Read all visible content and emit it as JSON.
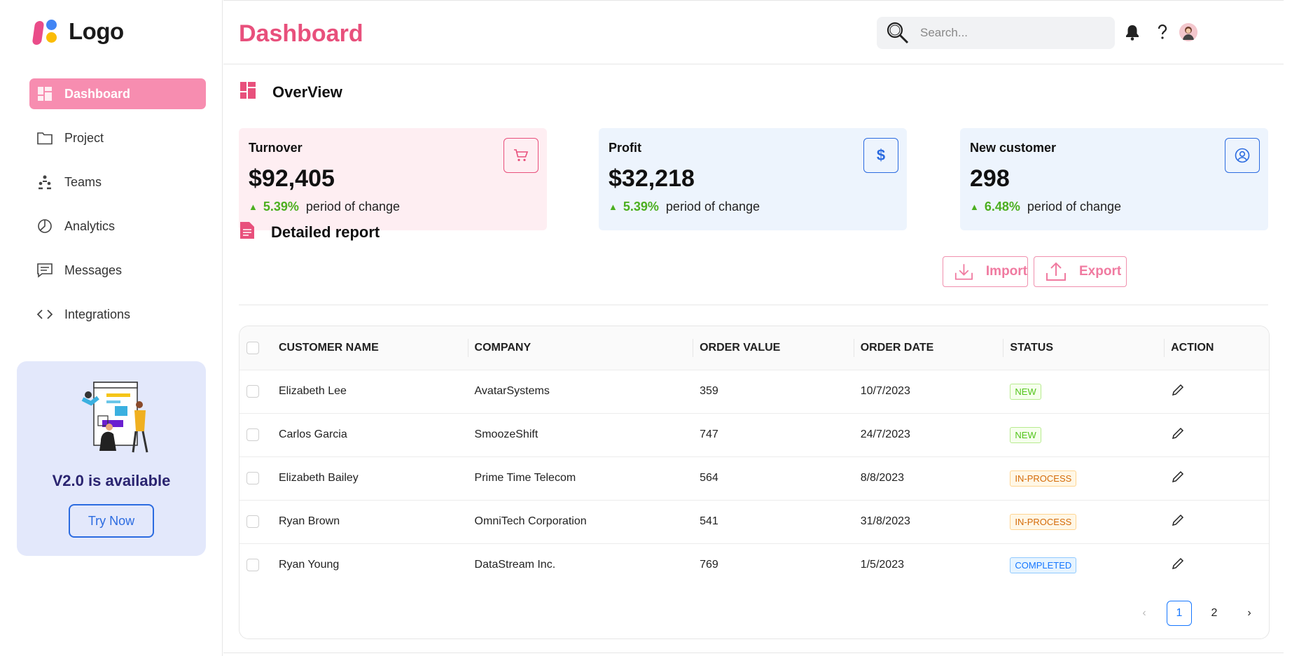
{
  "logo": {
    "text": "Logo"
  },
  "sidebar": {
    "items": [
      {
        "label": "Dashboard",
        "icon": "dashboard-icon",
        "active": true
      },
      {
        "label": "Project",
        "icon": "folder-icon"
      },
      {
        "label": "Teams",
        "icon": "teams-icon"
      },
      {
        "label": "Analytics",
        "icon": "pie-chart-icon"
      },
      {
        "label": "Messages",
        "icon": "message-icon"
      },
      {
        "label": "Integrations",
        "icon": "code-icon"
      }
    ],
    "promo": {
      "title": "V2.0 is available",
      "button": "Try Now"
    }
  },
  "header": {
    "title": "Dashboard",
    "search_placeholder": "Search..."
  },
  "overview": {
    "title": "OverView",
    "cards": [
      {
        "label": "Turnover",
        "value": "$92,405",
        "change": "5.39%",
        "change_text": "period of change",
        "icon": "cart-icon",
        "color": "#e8507c"
      },
      {
        "label": "Profit",
        "value": "$32,218",
        "change": "5.39%",
        "change_text": "period of change",
        "icon": "dollar-icon",
        "color": "#2b6be0"
      },
      {
        "label": "New customer",
        "value": "298",
        "change": "6.48%",
        "change_text": "period of change",
        "icon": "user-circle-icon",
        "color": "#2b6be0"
      }
    ]
  },
  "report": {
    "title": "Detailed report",
    "import_label": "Import",
    "export_label": "Export",
    "columns": [
      "CUSTOMER NAME",
      "COMPANY",
      "ORDER VALUE",
      "ORDER DATE",
      "STATUS",
      "ACTION"
    ],
    "rows": [
      {
        "name": "Elizabeth Lee",
        "company": "AvatarSystems",
        "value": "359",
        "date": "10/7/2023",
        "status": "NEW"
      },
      {
        "name": "Carlos Garcia",
        "company": "SmoozeShift",
        "value": "747",
        "date": "24/7/2023",
        "status": "NEW"
      },
      {
        "name": "Elizabeth Bailey",
        "company": "Prime Time Telecom",
        "value": "564",
        "date": "8/8/2023",
        "status": "IN-PROCESS"
      },
      {
        "name": "Ryan Brown",
        "company": "OmniTech Corporation",
        "value": "541",
        "date": "31/8/2023",
        "status": "IN-PROCESS"
      },
      {
        "name": "Ryan Young",
        "company": "DataStream Inc.",
        "value": "769",
        "date": "1/5/2023",
        "status": "COMPLETED"
      }
    ],
    "pagination": {
      "pages": [
        "1",
        "2"
      ],
      "current": "1"
    }
  },
  "colors": {
    "accent_pink": "#e8507c",
    "accent_blue": "#2b6be0",
    "positive": "#4caf20"
  }
}
